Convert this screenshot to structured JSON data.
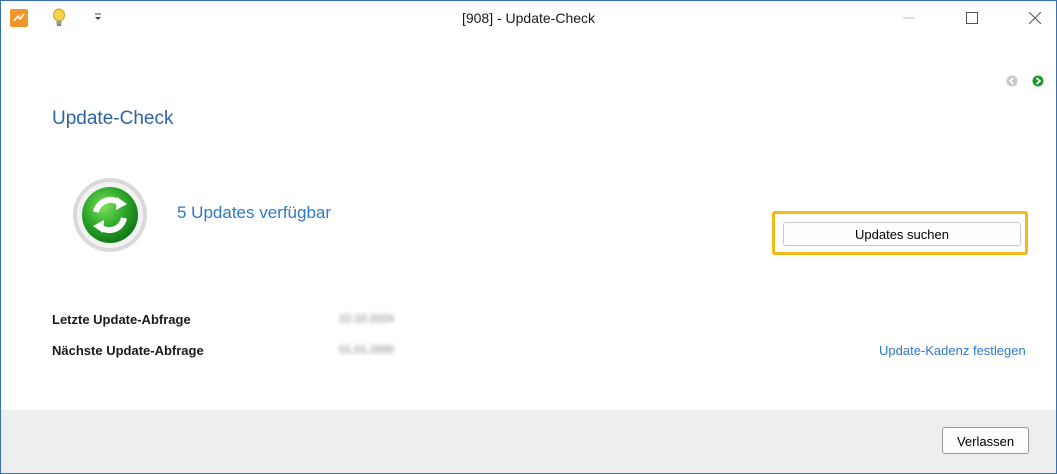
{
  "window": {
    "title": "[908] - Update-Check",
    "app_icon": "app-logo-icon",
    "quick_access": [
      "lightbulb-icon",
      "customize-quick-access-icon"
    ],
    "controls": [
      "minimize-icon",
      "maximize-icon",
      "close-icon"
    ]
  },
  "nav": {
    "back_icon": "back-arrow-icon",
    "forward_icon": "forward-arrow-icon",
    "forward_color": "#1f9a2c"
  },
  "content": {
    "heading": "Update-Check",
    "status_icon": "refresh-sync-icon",
    "status_text": "5 Updates verfügbar",
    "search_button": "Updates suchen",
    "highlight_color": "#f3b81a",
    "last_check_label": "Letzte Update-Abfrage",
    "last_check_value": "22.10.2024",
    "next_check_label": "Nächste Update-Abfrage",
    "next_check_value": "01.01.2000",
    "cadence_link": "Update-Kadenz festlegen"
  },
  "footer": {
    "exit_button": "Verlassen"
  }
}
